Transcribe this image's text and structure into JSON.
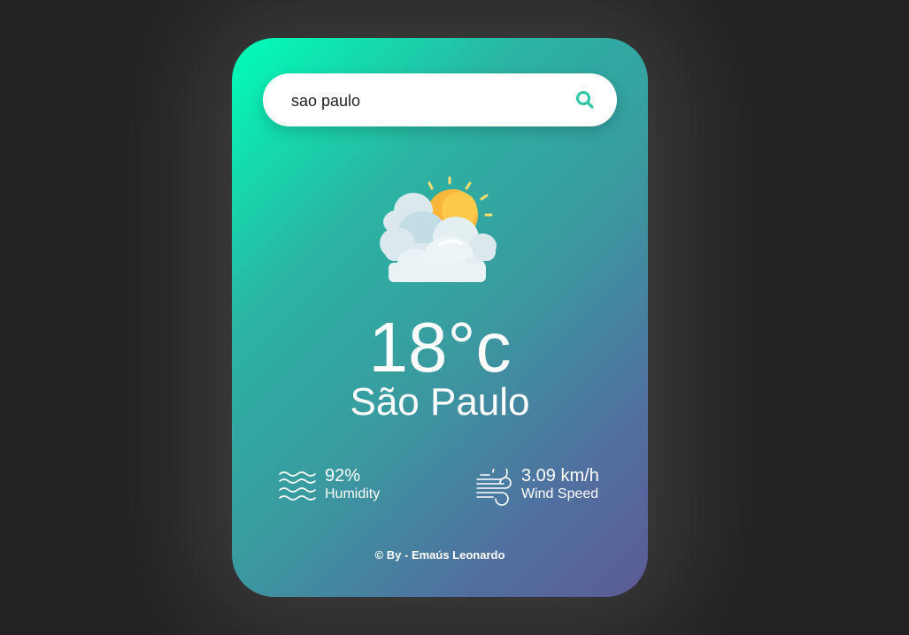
{
  "search": {
    "value": "sao paulo",
    "icon": "search-icon"
  },
  "weather": {
    "icon": "partly-cloudy-icon",
    "temperature": "18°c",
    "city": "São Paulo"
  },
  "details": {
    "humidity": {
      "value": "92%",
      "label": "Humidity",
      "icon": "humidity-waves-icon"
    },
    "wind": {
      "value": "3.09 km/h",
      "label": "Wind Speed",
      "icon": "wind-icon"
    }
  },
  "footer": {
    "text": "© By - Emaús Leonardo"
  },
  "colors": {
    "background": "#222222",
    "gradient_start": "#00ffb9",
    "gradient_end": "#5c5b96",
    "accent": "#2dc6a6"
  }
}
